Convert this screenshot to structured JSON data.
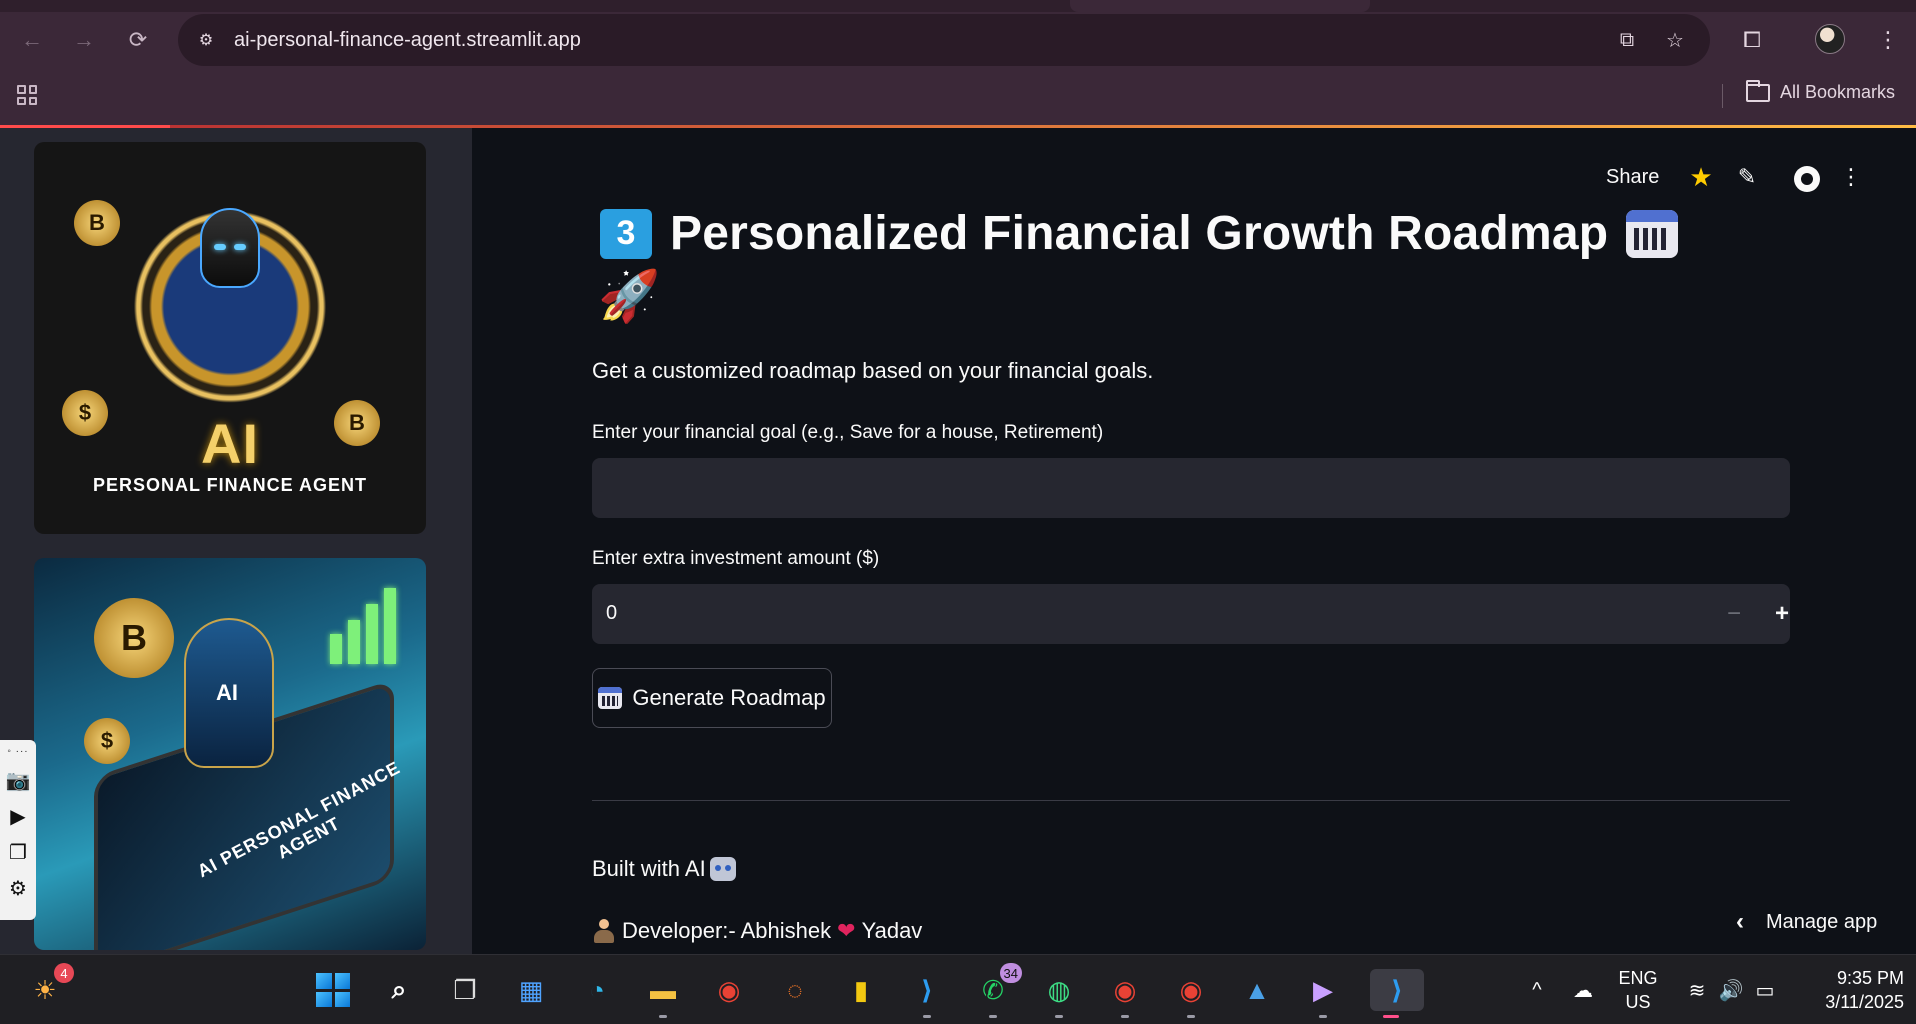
{
  "browser": {
    "url": "ai-personal-finance-agent.streamlit.app",
    "bookmarks_label": "All Bookmarks"
  },
  "sidebar": {
    "image1": {
      "logo_text": "AI",
      "caption": "PERSONAL FINANCE AGENT",
      "coin_symbol": "B",
      "dollar": "$"
    },
    "image2": {
      "robot_text": "AI",
      "caption": "AI PERSONAL FINANCE AGENT",
      "coin_symbol": "B",
      "dollar": "$"
    },
    "tools_dots": "◦ ···"
  },
  "header": {
    "share_label": "Share"
  },
  "main": {
    "title_number": "3",
    "title": "Personalized Financial Growth Roadmap",
    "subtitle": "Get a customized roadmap based on your financial goals.",
    "goal_label": "Enter your financial goal (e.g., Save for a house, Retirement)",
    "goal_value": "",
    "amount_label": "Enter extra investment amount ($)",
    "amount_value": "0",
    "minus": "−",
    "plus": "+",
    "button_label": "Generate Roadmap",
    "built_with": "Built with AI",
    "developer_prefix": "Developer:- Abhishek",
    "developer_suffix": "Yadav",
    "heart": "❤",
    "manage_app": "Manage app"
  },
  "taskbar": {
    "weather_badge": "4",
    "whatsapp_badge": "34",
    "language_line1": "ENG",
    "language_line2": "US",
    "time": "9:35 PM",
    "date": "3/11/2025"
  }
}
